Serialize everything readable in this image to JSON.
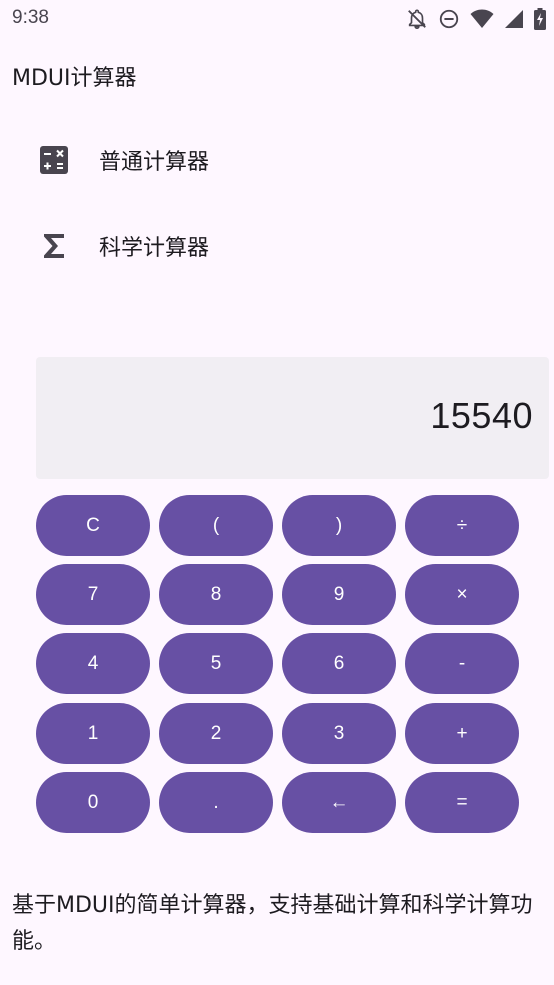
{
  "status_bar": {
    "time": "9:38",
    "icons": [
      "notifications-off-icon",
      "do-not-disturb-icon",
      "wifi-icon",
      "signal-icon",
      "battery-icon"
    ]
  },
  "app_bar": {
    "title": "MDUI计算器"
  },
  "nav": {
    "items": [
      {
        "label": "普通计算器",
        "icon": "calculator-icon"
      },
      {
        "label": "科学计算器",
        "icon": "sigma-icon"
      }
    ]
  },
  "display": {
    "value": "15540"
  },
  "keypad": {
    "keys": [
      {
        "label": "C",
        "name": "clear"
      },
      {
        "label": "(",
        "name": "open-paren"
      },
      {
        "label": ")",
        "name": "close-paren"
      },
      {
        "label": "÷",
        "name": "divide"
      },
      {
        "label": "7",
        "name": "7"
      },
      {
        "label": "8",
        "name": "8"
      },
      {
        "label": "9",
        "name": "9"
      },
      {
        "label": "×",
        "name": "multiply"
      },
      {
        "label": "4",
        "name": "4"
      },
      {
        "label": "5",
        "name": "5"
      },
      {
        "label": "6",
        "name": "6"
      },
      {
        "label": "-",
        "name": "subtract"
      },
      {
        "label": "1",
        "name": "1"
      },
      {
        "label": "2",
        "name": "2"
      },
      {
        "label": "3",
        "name": "3"
      },
      {
        "label": "+",
        "name": "add"
      },
      {
        "label": "0",
        "name": "0"
      },
      {
        "label": ".",
        "name": "decimal"
      },
      {
        "label": "←",
        "name": "backspace"
      },
      {
        "label": "=",
        "name": "equals"
      }
    ]
  },
  "footer": {
    "description": "基于MDUI的简单计算器，支持基础计算和科学计算功能。"
  },
  "colors": {
    "background": "#fef7ff",
    "key": "#6750a4",
    "key_text": "#ffffff",
    "display_bg": "#f1eef3"
  }
}
